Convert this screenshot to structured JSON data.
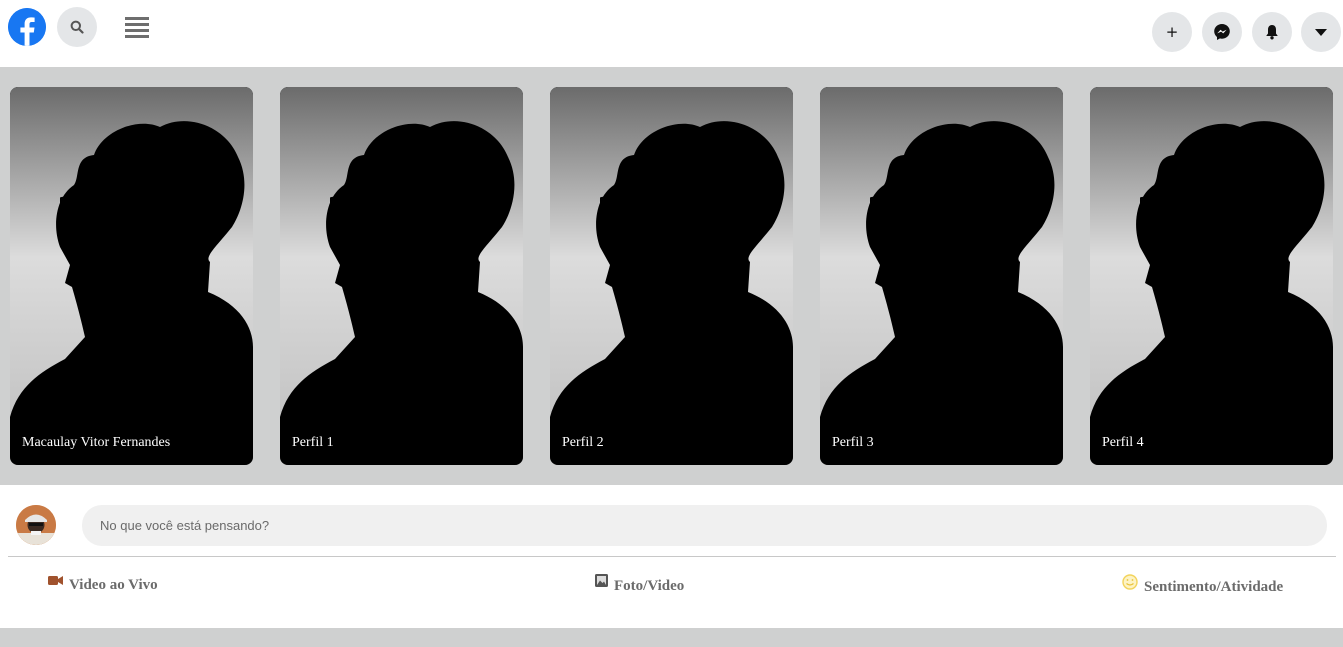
{
  "header": {
    "logo_icon": "facebook-logo-icon",
    "search_icon": "search-icon",
    "menu_icon": "hamburger-menu-icon",
    "actions": [
      {
        "icon": "plus-icon",
        "glyph": "+"
      },
      {
        "icon": "messenger-icon"
      },
      {
        "icon": "bell-icon"
      },
      {
        "icon": "caret-down-icon"
      }
    ],
    "brand_color": "#1877f2"
  },
  "stories": [
    {
      "name": "Macaulay Vitor Fernandes"
    },
    {
      "name": "Perfil 1"
    },
    {
      "name": "Perfil 2"
    },
    {
      "name": "Perfil 3"
    },
    {
      "name": "Perfil 4"
    }
  ],
  "composer": {
    "placeholder": "No que você está pensando?",
    "actions": [
      {
        "label": "Video ao Vivo",
        "icon": "video-camera-icon",
        "color": "#a0522d"
      },
      {
        "label": "Foto/Video",
        "icon": "photo-icon",
        "color": "#555555"
      },
      {
        "label": "Sentimento/Atividade",
        "icon": "smiley-icon",
        "color": "#f2d35b"
      }
    ]
  }
}
